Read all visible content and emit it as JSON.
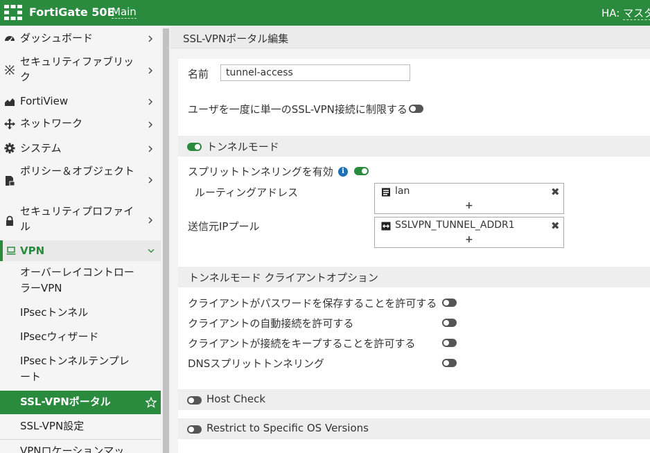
{
  "header": {
    "product": "FortiGate 50E",
    "vdom": "Main",
    "ha_label": "HA:",
    "ha_value": "マスタ",
    "brand_color": "#2a8a3e"
  },
  "sidebar": {
    "items": [
      {
        "label": "ダッシュボード",
        "icon": "dashboard-icon"
      },
      {
        "label": "セキュリティファブリック",
        "icon": "fabric-icon"
      },
      {
        "label": "FortiView",
        "icon": "chart-icon"
      },
      {
        "label": "ネットワーク",
        "icon": "network-icon"
      },
      {
        "label": "システム",
        "icon": "gear-icon"
      },
      {
        "label": "ポリシー＆オブジェクト",
        "icon": "policy-icon"
      },
      {
        "label": "セキュリティプロファイル",
        "icon": "lock-icon"
      }
    ],
    "vpn": {
      "label": "VPN",
      "icon": "laptop-icon",
      "expanded": true
    },
    "vpn_items": [
      {
        "label": "オーバーレイコントローラーVPN"
      },
      {
        "label": "IPsecトンネル"
      },
      {
        "label": "IPsecウィザード"
      },
      {
        "label": "IPsecトンネルテンプレート"
      },
      {
        "label": "SSL-VPNポータル",
        "active": true
      },
      {
        "label": "SSL-VPN設定"
      },
      {
        "label": "VPNロケーションマップ"
      }
    ]
  },
  "page": {
    "title": "SSL-VPNポータル編集",
    "name_label": "名前",
    "name_value": "tunnel-access",
    "limit_user_label": "ユーザを一度に単一のSSL-VPN接続に制限する",
    "limit_user_enabled": false,
    "tunnel_mode": {
      "label": "トンネルモード",
      "enabled": true,
      "split_tunnel_label": "スプリットトンネリングを有効",
      "split_tunnel_enabled": true,
      "routing_address_label": "ルーティングアドレス",
      "routing_address": {
        "value": "lan",
        "add": "+",
        "remove": "✖"
      },
      "source_ip_pool_label": "送信元IPプール",
      "source_ip_pool": {
        "value": "SSLVPN_TUNNEL_ADDR1",
        "add": "+",
        "remove": "✖"
      }
    },
    "client_options": {
      "title": "トンネルモード クライアントオプション",
      "options": [
        {
          "label": "クライアントがパスワードを保存することを許可する",
          "enabled": false
        },
        {
          "label": "クライアントの自動接続を許可する",
          "enabled": false
        },
        {
          "label": "クライアントが接続をキープすることを許可する",
          "enabled": false
        },
        {
          "label": "DNSスプリットトンネリング",
          "enabled": false
        }
      ]
    },
    "host_check": {
      "label": "Host Check",
      "enabled": false
    },
    "restrict_os": {
      "label": "Restrict to Specific OS Versions",
      "enabled": false
    }
  }
}
